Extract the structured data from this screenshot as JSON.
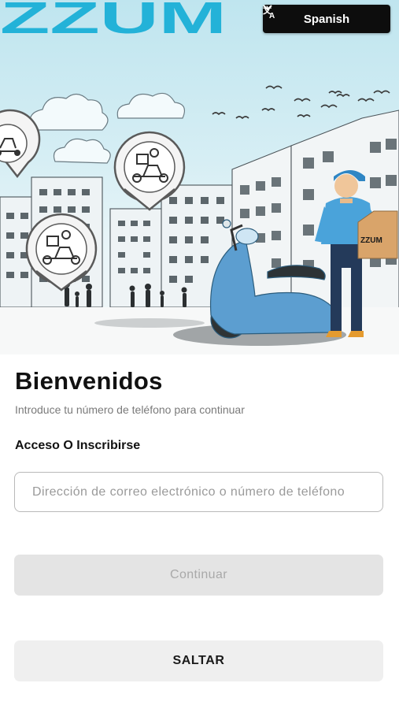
{
  "header": {
    "brand_name": "ZZUM",
    "brand_color": "#23b2d8",
    "language_selector": {
      "label": "Spanish",
      "icon": "translate-icon",
      "chevron_icon": "chevron-down-icon"
    }
  },
  "hero": {
    "scooter_bag_label": "ZZUM",
    "illustration_icons": [
      "delivery-scooter-pin-icon",
      "delivery-scooter-pin-icon",
      "delivery-scooter-pin-icon"
    ]
  },
  "welcome": {
    "title": "Bienvenidos",
    "subtitle": "Introduce tu número de teléfono para continuar"
  },
  "login": {
    "section_label": "Acceso O Inscribirse",
    "input_placeholder": "Dirección de correo electrónico o número de teléfono",
    "input_value": "",
    "continue_label": "Continuar",
    "skip_label": "SALTAR"
  },
  "colors": {
    "accent": "#23b2d8",
    "language_button_bg": "#0d0d0d",
    "continue_disabled_bg": "#e4e4e4",
    "skip_bg": "#efefef"
  }
}
